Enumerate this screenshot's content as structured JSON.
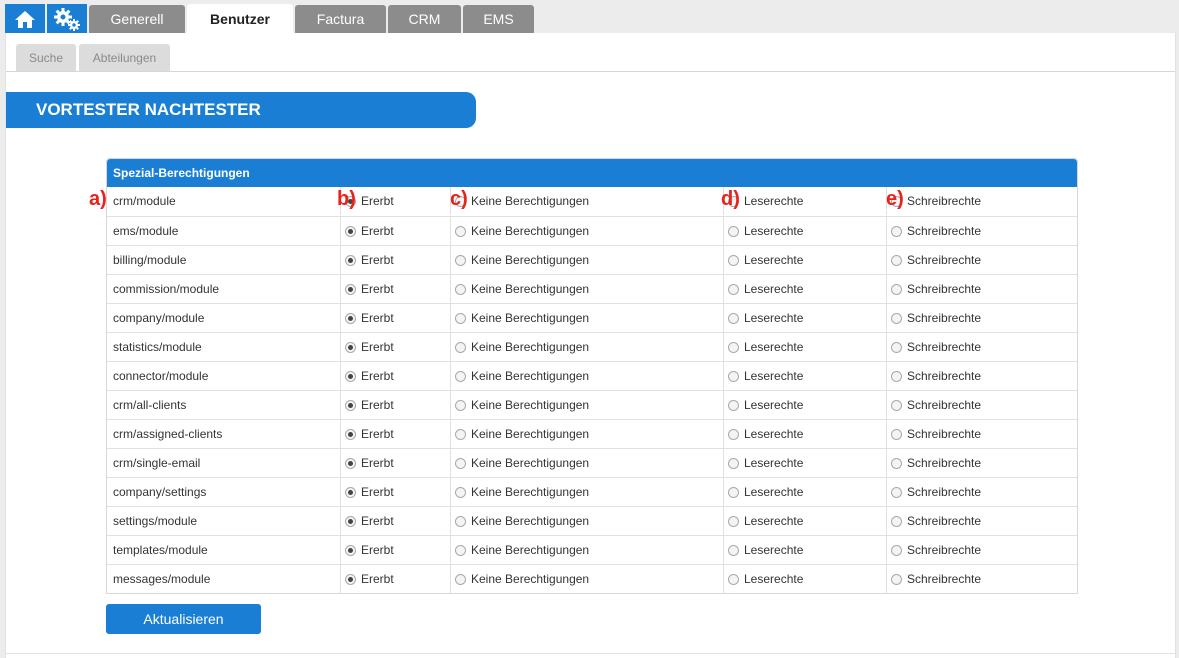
{
  "top_tabs": [
    {
      "label": "Generell"
    },
    {
      "label": "Benutzer"
    },
    {
      "label": "Factura"
    },
    {
      "label": "CRM"
    },
    {
      "label": "EMS"
    }
  ],
  "sub_tabs": [
    {
      "label": "Suche"
    },
    {
      "label": "Abteilungen"
    }
  ],
  "heading": "VORTESTER NACHTESTER",
  "table": {
    "header": "Spezial-Berechtigungen",
    "annotations": [
      "a)",
      "b)",
      "c)",
      "d)",
      "e)"
    ],
    "options": [
      "Ererbt",
      "Keine Berechtigungen",
      "Leserechte",
      "Schreibrechte"
    ],
    "rows": [
      {
        "name": "crm/module",
        "selected": 0
      },
      {
        "name": "ems/module",
        "selected": 0
      },
      {
        "name": "billing/module",
        "selected": 0
      },
      {
        "name": "commission/module",
        "selected": 0
      },
      {
        "name": "company/module",
        "selected": 0
      },
      {
        "name": "statistics/module",
        "selected": 0
      },
      {
        "name": "connector/module",
        "selected": 0
      },
      {
        "name": "crm/all-clients",
        "selected": 0
      },
      {
        "name": "crm/assigned-clients",
        "selected": 0
      },
      {
        "name": "crm/single-email",
        "selected": 0
      },
      {
        "name": "company/settings",
        "selected": 0
      },
      {
        "name": "settings/module",
        "selected": 0
      },
      {
        "name": "templates/module",
        "selected": 0
      },
      {
        "name": "messages/module",
        "selected": 0
      }
    ]
  },
  "update_button": "Aktualisieren",
  "colors": {
    "accent": "#1a7fd4",
    "annotation": "#e8231c"
  }
}
